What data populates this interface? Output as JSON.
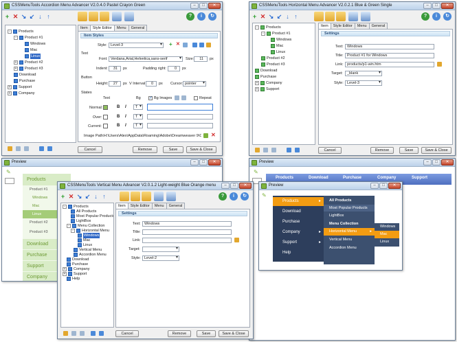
{
  "colors": {
    "win_border": "#6b7f96",
    "title_grad_top": "#dde9f6",
    "accent_green": "#7eb33d",
    "tree_selected": "#3169c6",
    "green_menu_bg": "#d9ecc7",
    "green_menu_text": "#6d9a34",
    "blue_menu_bg": "#5679c9",
    "dark_menu_bg": "#2d3e5c",
    "orange_menu": "#f39c12"
  },
  "accordion_win": {
    "title": "CSSMenuTools Accordion Menu Advancer V2.0.4.0     Pastel Crayon Green",
    "tree": [
      {
        "label": "Products",
        "level": 0,
        "sign": "-"
      },
      {
        "label": "Product #1",
        "level": 1,
        "sign": "-"
      },
      {
        "label": "Windows",
        "level": 2
      },
      {
        "label": "Mac",
        "level": 2
      },
      {
        "label": "Linux",
        "level": 2,
        "selected": true
      },
      {
        "label": "Product #2",
        "level": 1,
        "sign": "+"
      },
      {
        "label": "Product #3",
        "level": 1,
        "sign": "+"
      },
      {
        "label": "Download",
        "level": 0
      },
      {
        "label": "Purchase",
        "level": 0
      },
      {
        "label": "Support",
        "level": 0,
        "sign": "+"
      },
      {
        "label": "Company",
        "level": 0,
        "sign": "+"
      }
    ],
    "tabs": [
      "Item",
      "Style Editor",
      "Menu",
      "General"
    ],
    "section": "Item Styles",
    "style_label": "Style:",
    "style_value": "Level-3",
    "text_group": "Text",
    "font_label": "Font:",
    "font_value": "Verdana,Arial,Helvetica,sans-serif",
    "size_label": "Size:",
    "size_value": "11",
    "size_unit": "px",
    "indent_label": "Indent:",
    "indent_value": "31",
    "indent_unit": "px",
    "padding_label": "Padding right:",
    "padding_value": "0",
    "padding_unit": "px",
    "button_group": "Button",
    "height_label": "Height:",
    "height_value": "27",
    "height_unit": "px",
    "vinterval_label": "V Interval",
    "vinterval_value": "0",
    "vinterval_unit": "px",
    "cursor_label": "Cursor:",
    "cursor_value": "pointer",
    "states_group": "States",
    "col_text": "Text",
    "col_bg": "Bg",
    "bg_images_label": "Bg Images",
    "repeat_label": "Repeat",
    "states": [
      "Normal:",
      "Over:",
      "Current:"
    ],
    "image_path_label": "Image Path:",
    "image_path_value": "H:\\Users\\Alex\\AppData\\Roaming\\Adobe\\Dreamweaver 9\\Configuration",
    "btn_cancel": "Cancel",
    "btn_remove": "Remove",
    "btn_save": "Save",
    "btn_save_close": "Save & Close"
  },
  "horizontal_win": {
    "title": "CSSMenuTools Horizontal Menu Advancer V2.0.2.1     Blue & Green Single",
    "tree": [
      {
        "label": "Products",
        "level": 0,
        "sign": "-"
      },
      {
        "label": "Product #1",
        "level": 1,
        "sign": "-"
      },
      {
        "label": "Windows",
        "level": 2
      },
      {
        "label": "Mac",
        "level": 2
      },
      {
        "label": "Linux",
        "level": 2
      },
      {
        "label": "Product #2",
        "level": 1
      },
      {
        "label": "Product #3",
        "level": 1
      },
      {
        "label": "Download",
        "level": 0
      },
      {
        "label": "Purchase",
        "level": 0
      },
      {
        "label": "Company",
        "level": 0,
        "sign": "+"
      },
      {
        "label": "Support",
        "level": 0,
        "sign": "+"
      }
    ],
    "tabs": [
      "Item",
      "Style Editor",
      "Menu",
      "General"
    ],
    "section": "Settings",
    "text_label": "Text:",
    "text_value": "Windows",
    "title_label": "Title:",
    "title_value": "Product #1 for Windows",
    "link_label": "Link:",
    "link_value": "products/p1-win.htm",
    "target_label": "Target:",
    "target_value": "_blank",
    "style_label": "Style:",
    "style_value": "Level-3",
    "btn_cancel": "Cancel",
    "btn_remove": "Remove",
    "btn_save": "Save",
    "btn_save_close": "Save & Close"
  },
  "preview_left": {
    "title": "Preview",
    "items": [
      "Products",
      "Product #1",
      "Windows",
      "Mac",
      "Linux",
      "Product #2",
      "Product #3",
      "Download",
      "Purchase",
      "Support",
      "Company"
    ]
  },
  "preview_right": {
    "title": "Preview",
    "menu_items": [
      "Products",
      "Download",
      "Purchase",
      "Company",
      "Support"
    ]
  },
  "vertical_win": {
    "title": "CSSMenuTools Vertical Menu Advancer V2.0.1.2     Light-weight Blue Orange menu",
    "tree": [
      {
        "label": "Products",
        "level": 0,
        "sign": "-"
      },
      {
        "label": "All Products",
        "level": 1
      },
      {
        "label": "Most Popular Products",
        "level": 1
      },
      {
        "label": "LightBox",
        "level": 1
      },
      {
        "label": "Menu Collection",
        "level": 1,
        "sign": "-"
      },
      {
        "label": "Horizontal Menu",
        "level": 2,
        "sign": "-"
      },
      {
        "label": "Windows",
        "level": 3,
        "selected": true
      },
      {
        "label": "Mac",
        "level": 3
      },
      {
        "label": "Linux",
        "level": 3
      },
      {
        "label": "Vertical Menu",
        "level": 2
      },
      {
        "label": "Accordion Menu",
        "level": 2
      },
      {
        "label": "Download",
        "level": 0
      },
      {
        "label": "Purchase",
        "level": 0
      },
      {
        "label": "Company",
        "level": 0,
        "sign": "+"
      },
      {
        "label": "Support",
        "level": 0,
        "sign": "+"
      },
      {
        "label": "Help",
        "level": 0
      }
    ],
    "tabs": [
      "Item",
      "Style Editor",
      "Menu",
      "General"
    ],
    "section": "Settings",
    "text_label": "Text:",
    "text_value": "Windows",
    "title_label": "Title:",
    "title_value": "",
    "link_label": "Link:",
    "link_value": "",
    "target_label": "Target:",
    "target_value": "",
    "style_label": "Style:",
    "style_value": "Level-2",
    "btn_cancel": "Cancel",
    "btn_remove": "Remove",
    "btn_save": "Save",
    "btn_save_close": "Save & Close"
  },
  "preview_vertical": {
    "title": "Preview",
    "main_items": [
      "Products",
      "Download",
      "Purchase",
      "Company",
      "Support",
      "Help"
    ],
    "sub1_items": [
      "All Products",
      "Most Popular Products",
      "LightBox",
      "Menu Collection",
      "Horizontal Menu",
      "Vertical Menu",
      "Accordion Menu"
    ],
    "sub2_items": [
      "Windows",
      "Mac",
      "Linux"
    ]
  }
}
